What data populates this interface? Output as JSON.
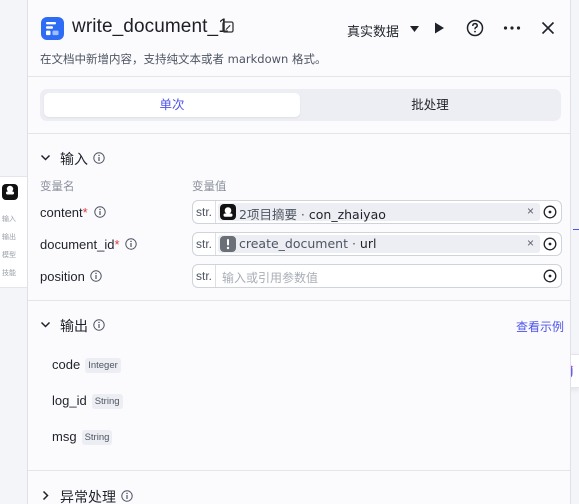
{
  "background_node": {
    "lines": [
      "输入",
      "输出",
      "模型",
      "技能"
    ]
  },
  "header": {
    "title": "write_document_1",
    "run_mode": "真实数据",
    "description": "在文档中新增内容，支持纯文本或者 markdown 格式。"
  },
  "tabs": [
    {
      "label": "单次",
      "active": true
    },
    {
      "label": "批处理",
      "active": false
    }
  ],
  "input_section": {
    "label": "输入",
    "col_name": "变量名",
    "col_value": "变量值",
    "params": [
      {
        "name": "content",
        "required": true,
        "type": "str.",
        "ref_node": "2项目摘要",
        "ref_var": "con_zhaiyao",
        "placeholder": ""
      },
      {
        "name": "document_id",
        "required": true,
        "type": "str.",
        "ref_node": "create_document",
        "ref_var": "url",
        "placeholder": ""
      },
      {
        "name": "position",
        "required": false,
        "type": "str.",
        "ref_node": "",
        "ref_var": "",
        "placeholder": "输入或引用参数值"
      }
    ]
  },
  "output_section": {
    "label": "输出",
    "example_link": "查看示例",
    "fields": [
      {
        "name": "code",
        "type": "Integer"
      },
      {
        "name": "log_id",
        "type": "String"
      },
      {
        "name": "msg",
        "type": "String"
      }
    ]
  },
  "error_section": {
    "label": "异常处理"
  },
  "colors": {
    "accent": "#4d53e8",
    "node_icon": "#2f6cf6",
    "required": "#e0393f"
  }
}
